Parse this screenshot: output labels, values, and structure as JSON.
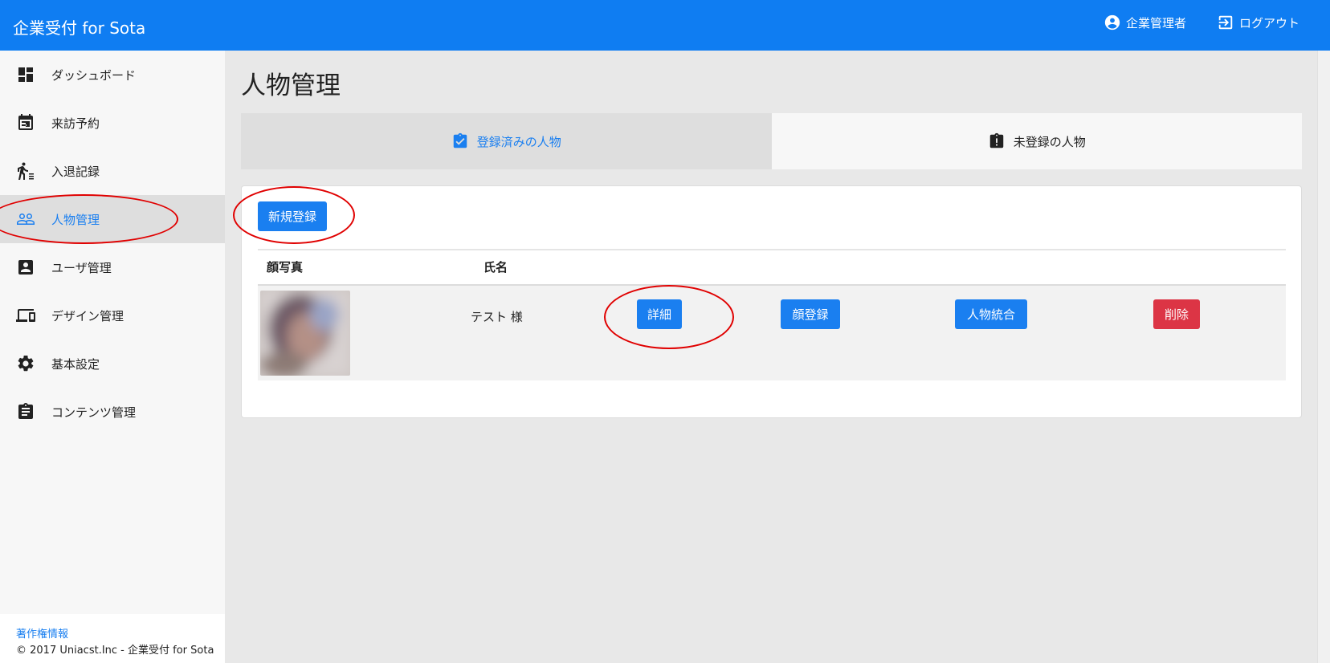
{
  "header": {
    "brand": "企業受付 for Sota",
    "user_label": "企業管理者",
    "logout_label": "ログアウト",
    "accent_color": "#0f7df2"
  },
  "sidebar": {
    "items": [
      {
        "label": "ダッシュボード",
        "icon": "dashboard-icon"
      },
      {
        "label": "来訪予約",
        "icon": "calendar-icon"
      },
      {
        "label": "入退記録",
        "icon": "walking-person-icon"
      },
      {
        "label": "人物管理",
        "icon": "people-icon",
        "active": true
      },
      {
        "label": "ユーザ管理",
        "icon": "account-box-icon"
      },
      {
        "label": "デザイン管理",
        "icon": "devices-icon"
      },
      {
        "label": "基本設定",
        "icon": "gear-icon"
      },
      {
        "label": "コンテンツ管理",
        "icon": "clipboard-icon"
      }
    ],
    "footer_link": "著作権情報",
    "footer_text": "© 2017 Uniacst.Inc - 企業受付 for Sota"
  },
  "main": {
    "title": "人物管理",
    "tabs": [
      {
        "label": "登録済みの人物",
        "icon": "clipboard-check-icon",
        "active": true
      },
      {
        "label": "未登録の人物",
        "icon": "clipboard-alert-icon",
        "active": false
      }
    ],
    "new_button": "新規登録",
    "table": {
      "headers": [
        "顔写真",
        "氏名"
      ],
      "rows": [
        {
          "name": "テスト 様",
          "actions": [
            "詳細",
            "顔登録",
            "人物統合",
            "削除"
          ]
        }
      ]
    }
  }
}
